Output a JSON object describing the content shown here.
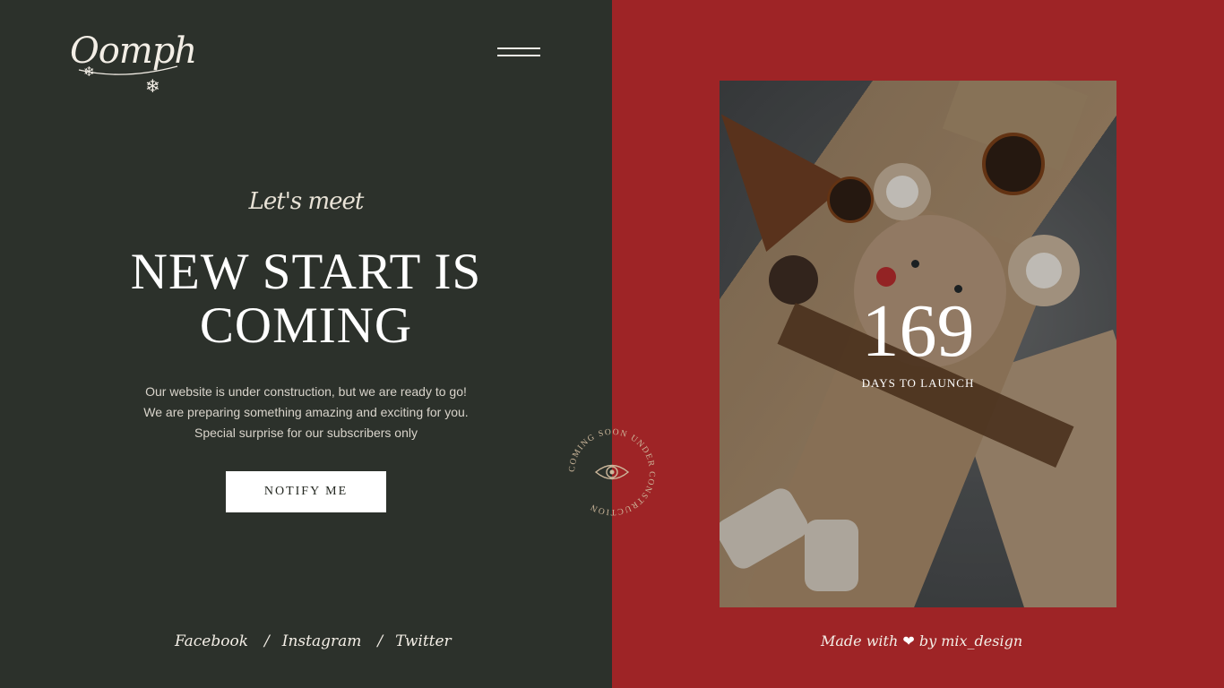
{
  "logo": {
    "text": "Oomph",
    "icon": "snowflake-icon"
  },
  "menu": {
    "icon": "hamburger-menu-icon"
  },
  "hero": {
    "kicker": "Let's meet",
    "title_line1": "NEW START IS",
    "title_line2": "COMING",
    "desc_line1": "Our website is under construction, but we are ready to go!",
    "desc_line2": "We are preparing something amazing and exciting for you.",
    "desc_line3": "Special surprise for our subscribers only",
    "button": "NOTIFY ME"
  },
  "social": {
    "links": [
      "Facebook",
      "Instagram",
      "Twitter"
    ],
    "separator": "/"
  },
  "countdown": {
    "value": "169",
    "label": "DAYS TO LAUNCH"
  },
  "badge": {
    "text": "COMING SOON UNDER CONSTRUCTION",
    "icon": "eye-icon"
  },
  "credit": {
    "prefix": "Made with",
    "suffix": "by mix_design",
    "icon": "heart-icon"
  },
  "colors": {
    "left_bg": "#2c312b",
    "right_bg": "#9e2426",
    "text": "#f3eee6"
  }
}
